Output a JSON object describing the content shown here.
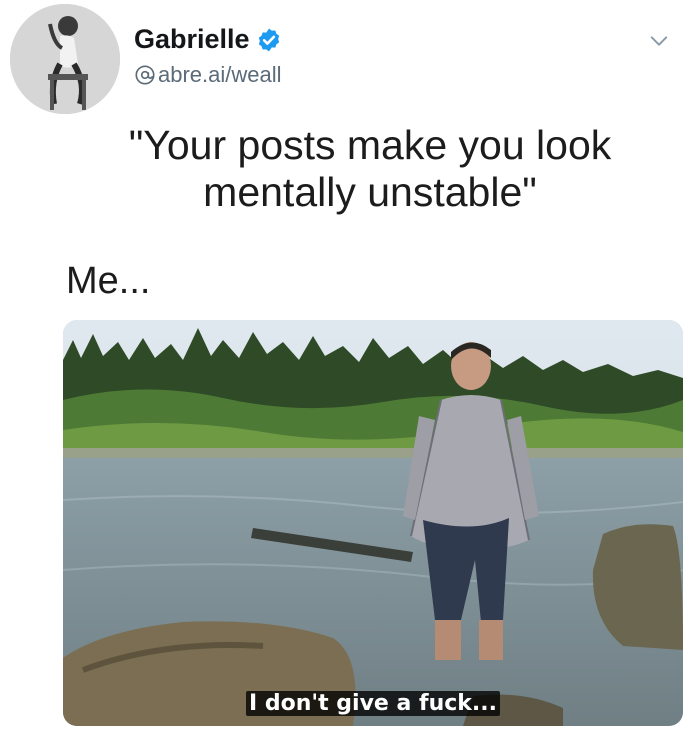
{
  "author": {
    "display_name": "Gabrielle",
    "handle": "abre.ai/weall",
    "verified": true,
    "verified_icon": "verified-badge-icon",
    "handle_icon": "at-sign-icon",
    "avatar": "vintage-pinup-photo"
  },
  "header": {
    "menu_icon": "chevron-down-icon"
  },
  "post": {
    "quote_line1": "\"Your posts make you look",
    "quote_line2": "mentally unstable\"",
    "me_label": "Me..."
  },
  "image": {
    "caption": "I don't give a fuck..."
  },
  "colors": {
    "verified_blue": "#1d9bf0",
    "text": "#14171a",
    "handle_gray": "#5b6b78"
  }
}
